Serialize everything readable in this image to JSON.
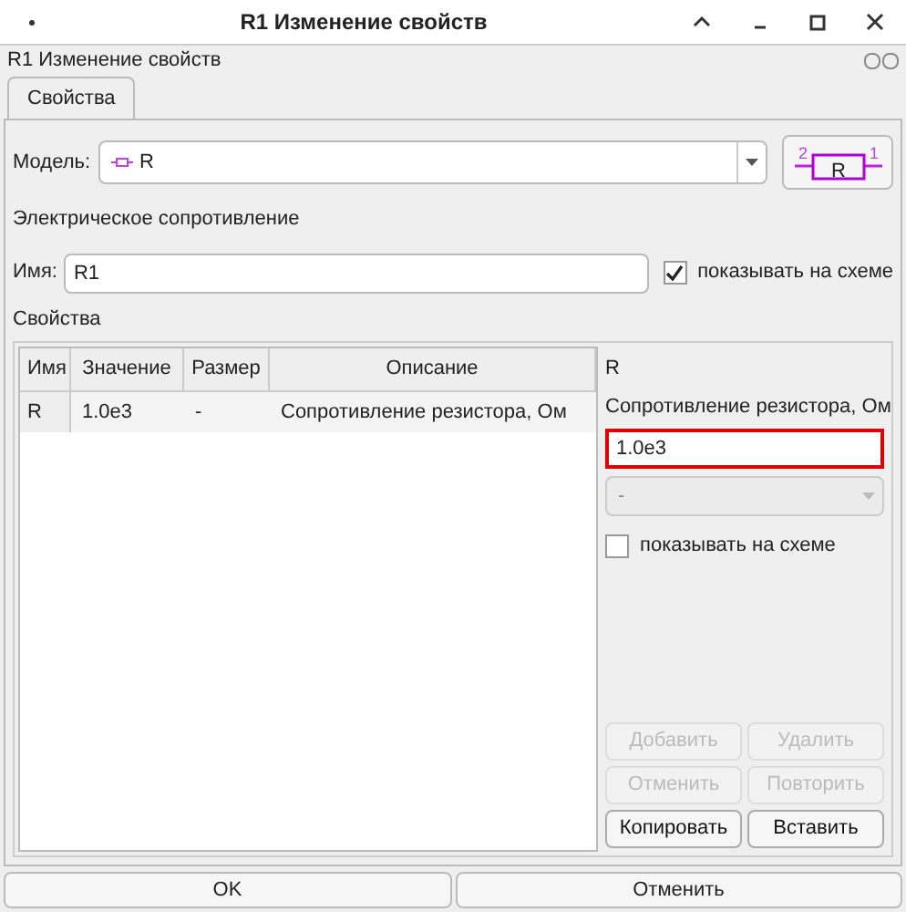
{
  "window": {
    "title": "R1 Изменение свойств"
  },
  "dock": {
    "title": "R1 Изменение свойств"
  },
  "tabs": [
    {
      "label": "Свойства",
      "selected": true
    }
  ],
  "model": {
    "label": "Модель:",
    "value": "R",
    "symbol": {
      "label": "R",
      "pins": [
        "2",
        "1"
      ]
    }
  },
  "description": "Электрическое сопротивление",
  "name": {
    "label": "Имя:",
    "value": "R1",
    "show_on_schematic": {
      "label": "показывать на схеме",
      "checked": true
    }
  },
  "properties_label": "Свойства",
  "table": {
    "columns": [
      "Имя",
      "Значение",
      "Размер",
      "Описание"
    ],
    "rows": [
      {
        "cells": [
          "R",
          "1.0e3",
          "-",
          "Сопротивление резистора, Ом"
        ],
        "selected": false
      }
    ]
  },
  "editor": {
    "name": "R",
    "description": "Сопротивление резистора, Ом",
    "value": "1.0e3",
    "unit": {
      "value": "-",
      "disabled": true
    },
    "show_on_schematic": {
      "label": "показывать на схеме",
      "checked": false
    }
  },
  "editor_buttons": [
    {
      "label": "Добавить",
      "disabled": true
    },
    {
      "label": "Удалить",
      "disabled": true
    },
    {
      "label": "Отменить",
      "disabled": true
    },
    {
      "label": "Повторить",
      "disabled": true
    },
    {
      "label": "Копировать",
      "disabled": false
    },
    {
      "label": "Вставить",
      "disabled": false
    }
  ],
  "buttons": [
    "OK",
    "Отменить"
  ]
}
